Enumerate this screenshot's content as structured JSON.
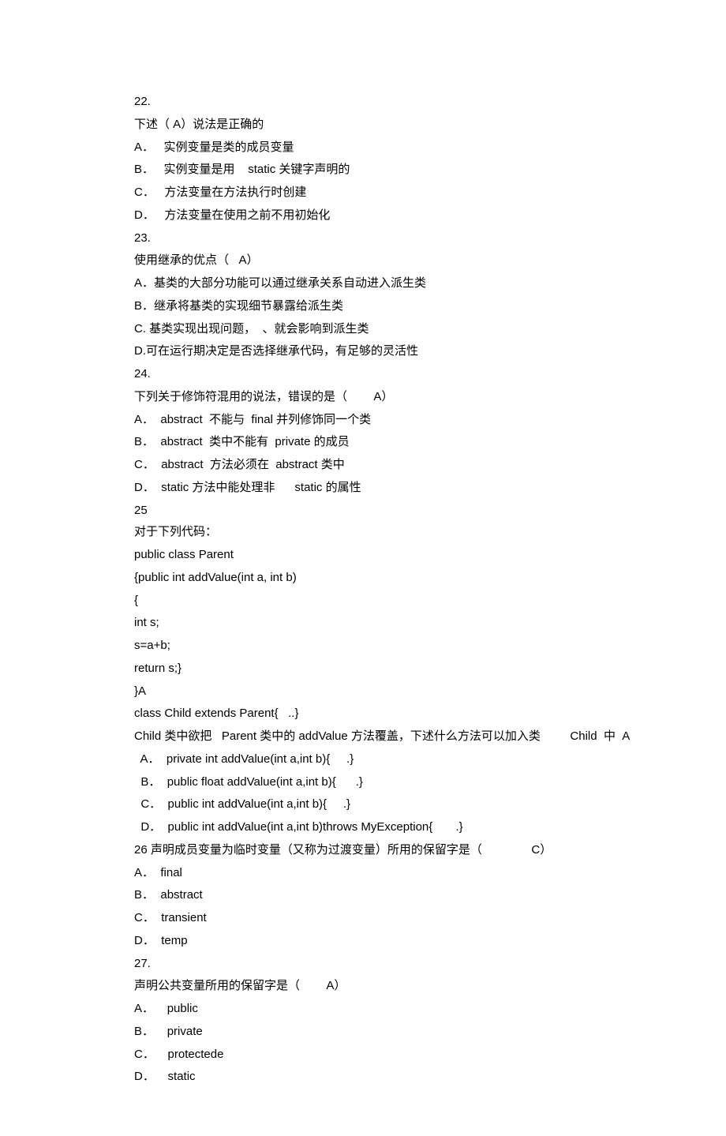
{
  "lines": [
    "22.",
    "下述（ A）说法是正确的",
    "A．   实例变量是类的成员变量",
    "B．   实例变量是用    static 关键字声明的",
    "C．   方法变量在方法执行时创建",
    "D．   方法变量在使用之前不用初始化",
    "23.",
    "使用继承的优点（   A）",
    "A．基类的大部分功能可以通过继承关系自动进入派生类",
    "B．继承将基类的实现细节暴露给派生类",
    "C. 基类实现出现问题，  、就会影响到派生类",
    "D.可在运行期决定是否选择继承代码，有足够的灵活性",
    "24.",
    "下列关于修饰符混用的说法，错误的是（        A）",
    "A．  abstract  不能与  final 并列修饰同一个类",
    "B．  abstract  类中不能有  private 的成员",
    "C．  abstract  方法必须在  abstract 类中",
    "D．  static 方法中能处理非      static 的属性",
    "25",
    "对于下列代码：",
    "public class Parent",
    "{public int addValue(int a, int b)",
    "{",
    "int s;",
    "s=a+b;",
    "return s;}",
    "}A",
    "class Child extends Parent{   ..}",
    "Child 类中欲把   Parent 类中的 addValue 方法覆盖，下述什么方法可以加入类         Child  中  A",
    "  A．  private int addValue(int a,int b){     .}",
    "  B．  public float addValue(int a,int b){      .}",
    "  C．  public int addValue(int a,int b){     .}",
    "  D．  public int addValue(int a,int b)throws MyException{       .}",
    "26 声明成员变量为临时变量（又称为过渡变量）所用的保留字是（               C）",
    "A．  final",
    "B．  abstract",
    "C．  transient",
    "D．  temp",
    "27.",
    "声明公共变量所用的保留字是（        A）",
    "A．    public",
    "B．    private",
    "C．    protectede",
    "D．    static"
  ]
}
